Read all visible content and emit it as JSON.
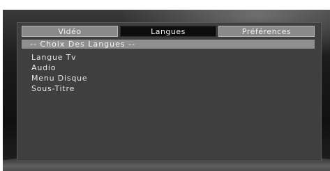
{
  "tabs": [
    {
      "label": "Vidéo"
    },
    {
      "label": "Langues"
    },
    {
      "label": "Préférences"
    }
  ],
  "active_tab": "Langues",
  "menu": {
    "header": "-- Choix Des Langues --",
    "items": [
      {
        "label": "Langue Tv"
      },
      {
        "label": "Audio"
      },
      {
        "label": "Menu Disque"
      },
      {
        "label": "Sous-Titre"
      }
    ]
  }
}
